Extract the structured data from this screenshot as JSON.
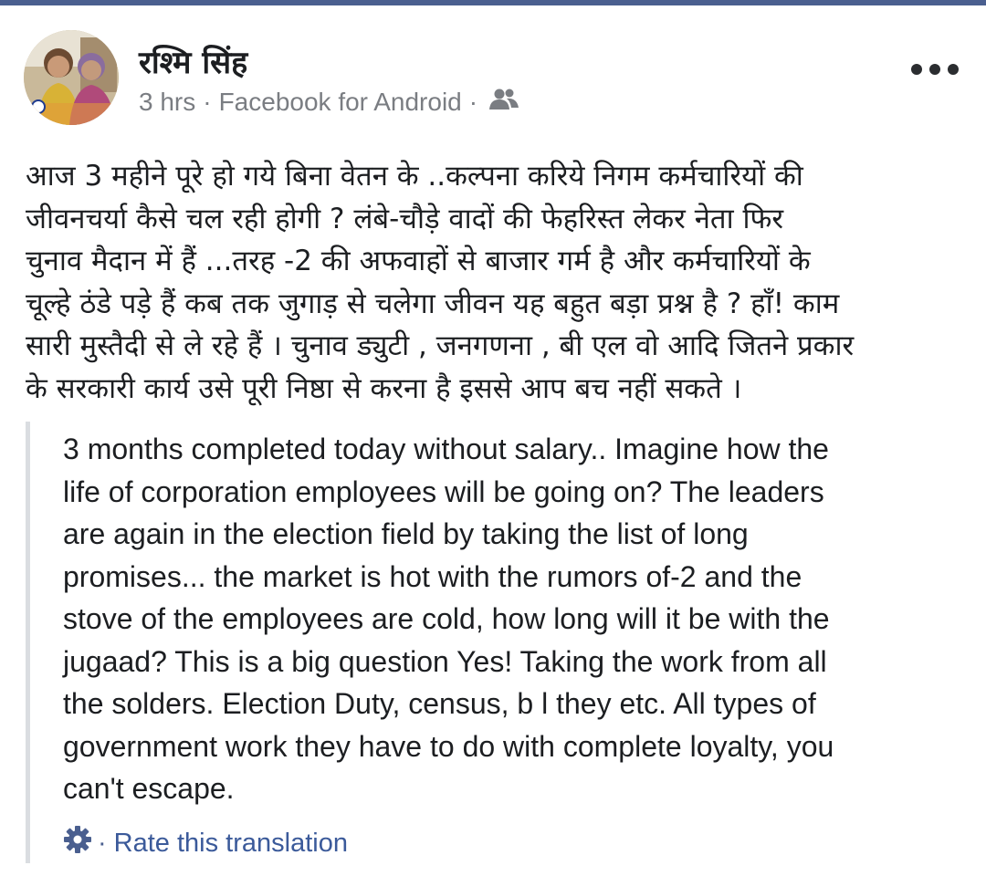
{
  "post": {
    "author": "रश्मि सिंह",
    "time": "3 hrs",
    "separator": "·",
    "source": "Facebook for Android",
    "audience_icon": "friends-icon",
    "menu_icon": "more-options-icon",
    "text_lines": [
      "आज 3 महीने पूरे हो गये बिना वेतन के ..कल्पना करिये निगम कर्मचारियों की",
      "जीवनचर्या कैसे चल रही होगी ? लंबे-चौड़े वादों की फेहरिस्त लेकर नेता फिर",
      "चुनाव मैदान में हैं ...तरह -2 की अफवाहों से बाजार गर्म है और कर्मचारियों के",
      "चूल्हे ठंडे पड़े हैं कब तक जुगाड़ से चलेगा जीवन यह बहुत बड़ा प्रश्न है ? हाँ! काम",
      "सारी मुस्तैदी से ले रहे हैं । चुनाव ड्युटी , जनगणना , बी एल वो आदि जितने प्रकार",
      "के सरकारी कार्य उसे पूरी निष्ठा से करना है इससे आप बच नहीं सकते ।"
    ]
  },
  "translation": {
    "lines": [
      "3 months completed today without salary.. Imagine how the",
      "life of corporation employees will be going on? The leaders",
      "are again in the election field by taking the list of long",
      "promises... the market is hot with the rumors of-2 and the",
      "stove of the employees are cold, how long will it be with the",
      "jugaad? This is a big question Yes! Taking the work from all",
      "the solders. Election Duty, census, b l they etc. All types of",
      "government work they have to do with complete loyalty, you",
      "can't escape."
    ],
    "settings_icon": "gear-icon",
    "rate_separator": "·",
    "rate_label": "Rate this translation"
  },
  "colors": {
    "top_bar": "#4a5f8f",
    "text": "#1c1e21",
    "meta": "#7a7d82",
    "link": "#3b5a9a",
    "quote_border": "#dadde1"
  }
}
